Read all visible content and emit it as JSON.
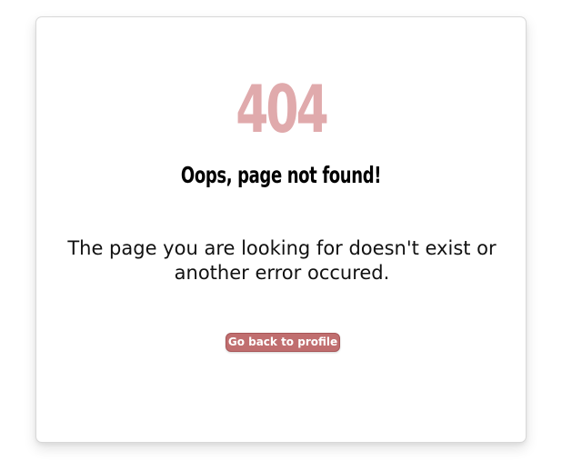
{
  "error": {
    "code": "404",
    "title": "Oops, page not found!",
    "message": "The page you are looking for doesn't exist or another error occured."
  },
  "actions": {
    "back_label": "Go back to profile"
  },
  "colors": {
    "code": "#e0aaac",
    "button": "#c06e6f",
    "text": "#000000"
  }
}
